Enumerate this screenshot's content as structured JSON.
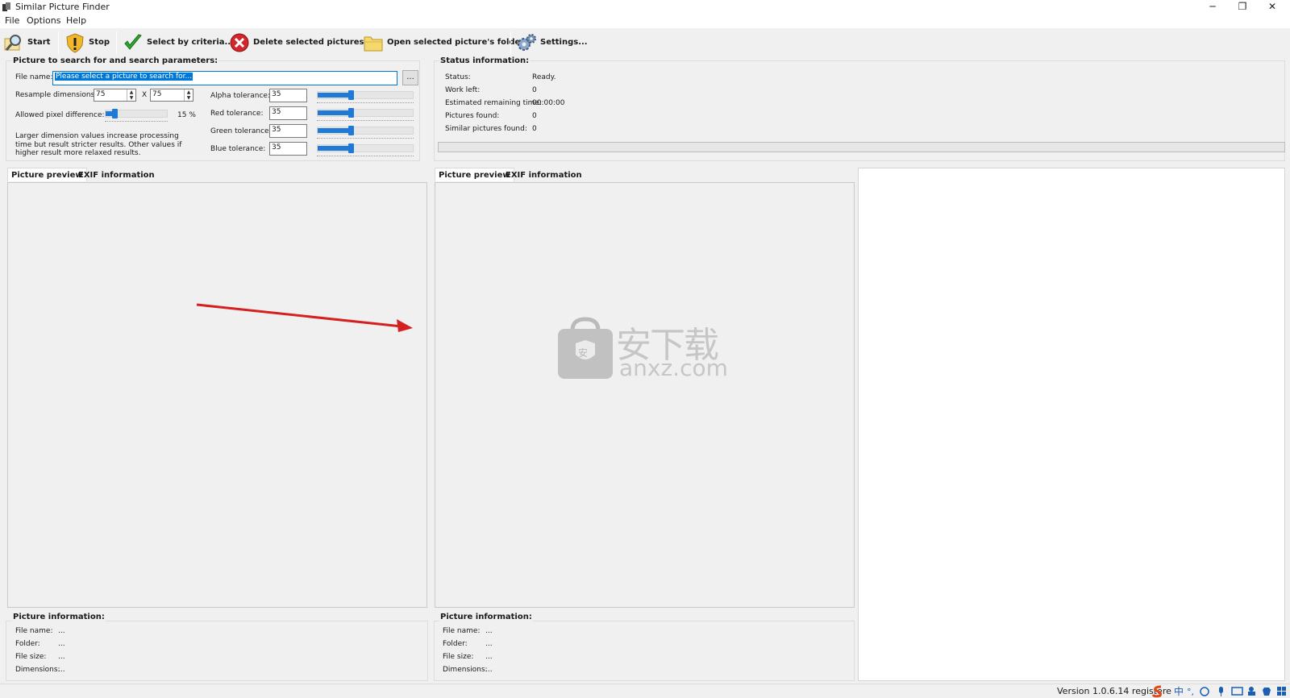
{
  "window": {
    "title": "Similar Picture Finder",
    "minimize": "─",
    "restore": "❐",
    "close": "✕"
  },
  "menu": [
    "File",
    "Options",
    "Help"
  ],
  "toolbar": {
    "start": "Start",
    "stop": "Stop",
    "select_by_criteria": "Select by criteria...",
    "delete_selected": "Delete selected pictures...",
    "open_folder": "Open selected picture's folder",
    "settings": "Settings..."
  },
  "search": {
    "group_title": "Picture to search for and search parameters:",
    "file_name_label": "File name:",
    "file_name_value": "Please select a picture to search for...",
    "browse_label": "...",
    "resample_label": "Resample dimensions:",
    "resample_w": "75",
    "resample_x": "X",
    "resample_h": "75",
    "pixel_diff_label": "Allowed pixel difference:",
    "pixel_diff_value": "15 %",
    "pixel_diff_level": 0.15,
    "note": "Larger dimension values increase processing time but result stricter results. Other values if higher result more relaxed results.",
    "tolerances": [
      {
        "label": "Alpha tolerance:",
        "value": "35",
        "level": 0.35
      },
      {
        "label": "Red tolerance:",
        "value": "35",
        "level": 0.35
      },
      {
        "label": "Green tolerance:",
        "value": "35",
        "level": 0.35
      },
      {
        "label": "Blue tolerance:",
        "value": "35",
        "level": 0.35
      }
    ]
  },
  "status": {
    "group_title": "Status information:",
    "rows": [
      {
        "label": "Status:",
        "value": "Ready."
      },
      {
        "label": "Work left:",
        "value": "0"
      },
      {
        "label": "Estimated remaining time:",
        "value": "00:00:00"
      },
      {
        "label": "Pictures found:",
        "value": "0"
      },
      {
        "label": "Similar pictures found:",
        "value": "0"
      }
    ],
    "progress": 0
  },
  "preview_tabs": {
    "preview": "Picture preview",
    "exif": "EXIF information"
  },
  "picture_info": {
    "title": "Picture information:",
    "rows": [
      {
        "label": "File name:",
        "value": "..."
      },
      {
        "label": "Folder:",
        "value": "..."
      },
      {
        "label": "File size:",
        "value": "..."
      },
      {
        "label": "Dimensions:",
        "value": "..."
      }
    ]
  },
  "watermark": {
    "cn": "安下载",
    "domain": "anxz.com",
    "badge": "安"
  },
  "statusbar": {
    "version": "Version 1.0.6.14 registere"
  },
  "colors": {
    "accent": "#1e79d7",
    "arrow": "#d42020"
  }
}
